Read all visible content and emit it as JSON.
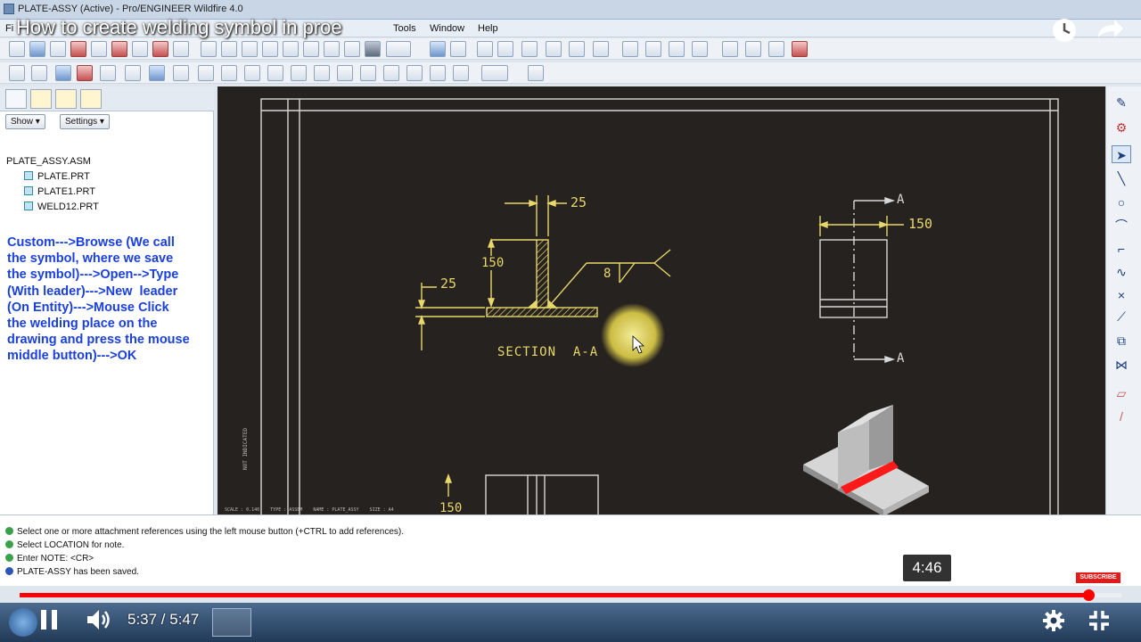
{
  "window": {
    "title": "PLATE-ASSY (Active) - Pro/ENGINEER Wildfire 4.0"
  },
  "menubar": {
    "items": [
      "Fi",
      "Tools",
      "Window",
      "Help"
    ]
  },
  "video": {
    "title": "How to create welding symbol in proe",
    "current_time": "5:37 / 5:47",
    "hover_time": "4:46",
    "progress_fraction": 0.97,
    "subscribe_label": "SUBSCRIBE",
    "accent_color": "#ff0000",
    "icons": [
      "watch-later-icon",
      "share-icon",
      "play-pause-icon",
      "volume-icon",
      "settings-icon",
      "exit-fullscreen-icon"
    ]
  },
  "left_panel": {
    "show_label": "Show ▾",
    "settings_label": "Settings ▾",
    "tree": {
      "root": "PLATE_ASSY.ASM",
      "children": [
        "PLATE.PRT",
        "PLATE1.PRT",
        "WELD12.PRT"
      ]
    },
    "annotation": "Custom--->Browse (We call\nthe symbol, where we save\nthe symbol)--->Open-->Type\n(With leader)--->New  leader\n(On Entity)--->Mouse Click\nthe welding place on the\ndrawing and press the mouse\nmiddle button)--->OK",
    "annotation_color": "#1a3fe0"
  },
  "drawing": {
    "dim_top": "25",
    "dim_left": "25",
    "dim_height": "150",
    "weld_size": "8",
    "section_label": "SECTION  A-A",
    "view_dim": "150",
    "cut_label_top": "A",
    "cut_label_bottom": "A",
    "bottom_dim": "150",
    "side_text": "NOT INDICATED",
    "footer_text": "SCALE : 0.140    TYPE : ASSEM    NAME : PLATE_ASSY    SIZE : A4",
    "line_color": "#e8d76a",
    "weld_bead_color": "#ff1a1a"
  },
  "messages": [
    "Select one or more attachment references using the left mouse button (+CTRL to add references).",
    "Select LOCATION for note.",
    "Enter NOTE:  <CR>",
    "PLATE-ASSY has been saved."
  ]
}
